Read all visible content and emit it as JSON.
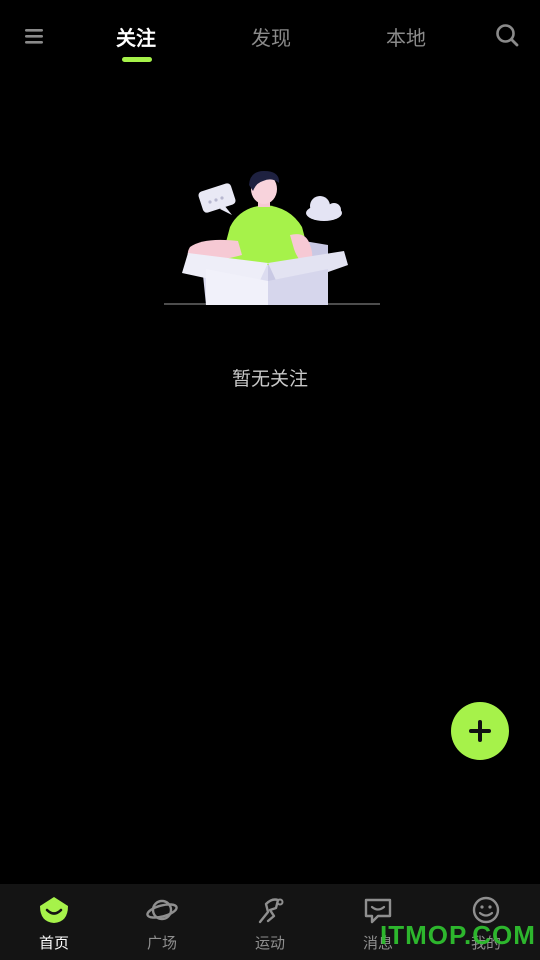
{
  "header": {
    "tabs": [
      {
        "label": "关注",
        "active": true
      },
      {
        "label": "发现",
        "active": false
      },
      {
        "label": "本地",
        "active": false
      }
    ],
    "menu_icon": "hamburger-icon",
    "search_icon": "search-icon",
    "accent_color": "#a6f24a"
  },
  "empty_state": {
    "message": "暂无关注",
    "illustration": "person-in-open-box"
  },
  "fab": {
    "icon": "plus-icon"
  },
  "bottom_nav": {
    "items": [
      {
        "label": "首页",
        "icon": "home-face-icon",
        "active": true
      },
      {
        "label": "广场",
        "icon": "planet-icon",
        "active": false
      },
      {
        "label": "运动",
        "icon": "running-icon",
        "active": false
      },
      {
        "label": "消息",
        "icon": "chat-bubble-icon",
        "active": false
      },
      {
        "label": "我的",
        "icon": "smile-face-icon",
        "active": false
      }
    ]
  },
  "watermark": "ITMOP.COM"
}
